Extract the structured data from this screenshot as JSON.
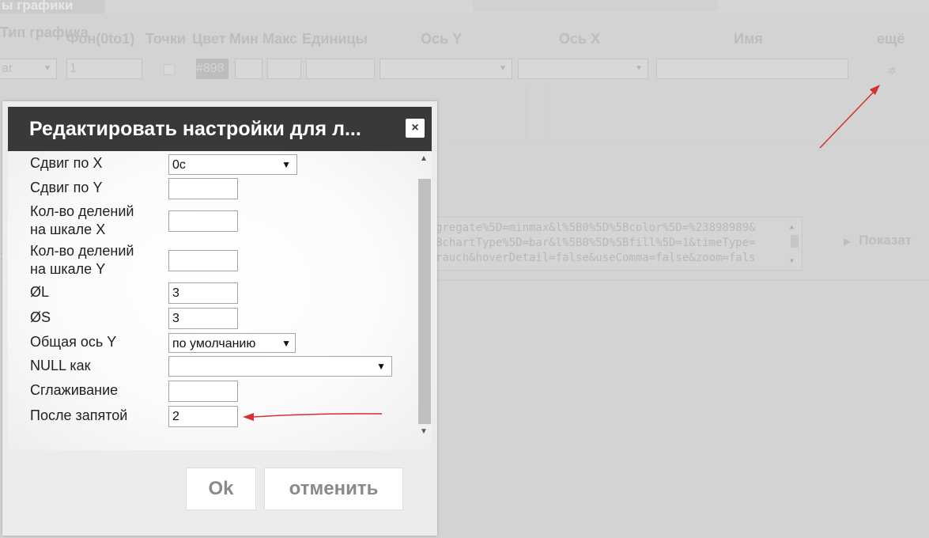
{
  "background": {
    "tab_label": "ы графики",
    "columns": {
      "type": "Тип графика",
      "background": "Фон(0to1)",
      "points": "Точки",
      "color": "Цвет",
      "min": "Мин",
      "max": "Макс",
      "units": "Единицы",
      "axis_y": "Ось Y",
      "axis_x": "Ось X",
      "name": "Имя",
      "more": "ещё"
    },
    "type_value": "ar",
    "background_value": "1",
    "color_value": "#898",
    "code_lines": [
      "gregate%5D=minmax&l%5B0%5D%5Bcolor%5D=%23898989&",
      "BchartType%5D=bar&l%5B0%5D%5Bfill%5D=1&timeType=",
      "rauch&hoverDetail=false&useComma=false&zoom=fals"
    ],
    "show_button": "Показат"
  },
  "dialog": {
    "title": "Редактировать настройки для л...",
    "close_symbol": "×",
    "rows": {
      "shift_x": {
        "label": "Сдвиг по X",
        "value": "0с"
      },
      "shift_y": {
        "label": "Сдвиг по Y",
        "value": ""
      },
      "divisions_x": {
        "label_line1": "Кол-во делений",
        "label_line2": "на шкале X",
        "value": ""
      },
      "divisions_y": {
        "label_line1": "Кол-во делений",
        "label_line2": "на шкале Y",
        "value": ""
      },
      "diam_l": {
        "label": "ØL",
        "value": "3"
      },
      "diam_s": {
        "label": "ØS",
        "value": "3"
      },
      "common_axis_y": {
        "label": "Общая ось Y",
        "value": "по умолчанию"
      },
      "null_as": {
        "label": "NULL как",
        "value": ""
      },
      "smoothing": {
        "label": "Сглаживание",
        "value": ""
      },
      "decimals": {
        "label": "После запятой",
        "value": "2"
      }
    },
    "ok_label": "Ok",
    "cancel_label": "отменить"
  },
  "colors": {
    "title_bar": "#393939",
    "annotation_arrow": "#d62f2f",
    "overlay": "#d3d3d3"
  }
}
